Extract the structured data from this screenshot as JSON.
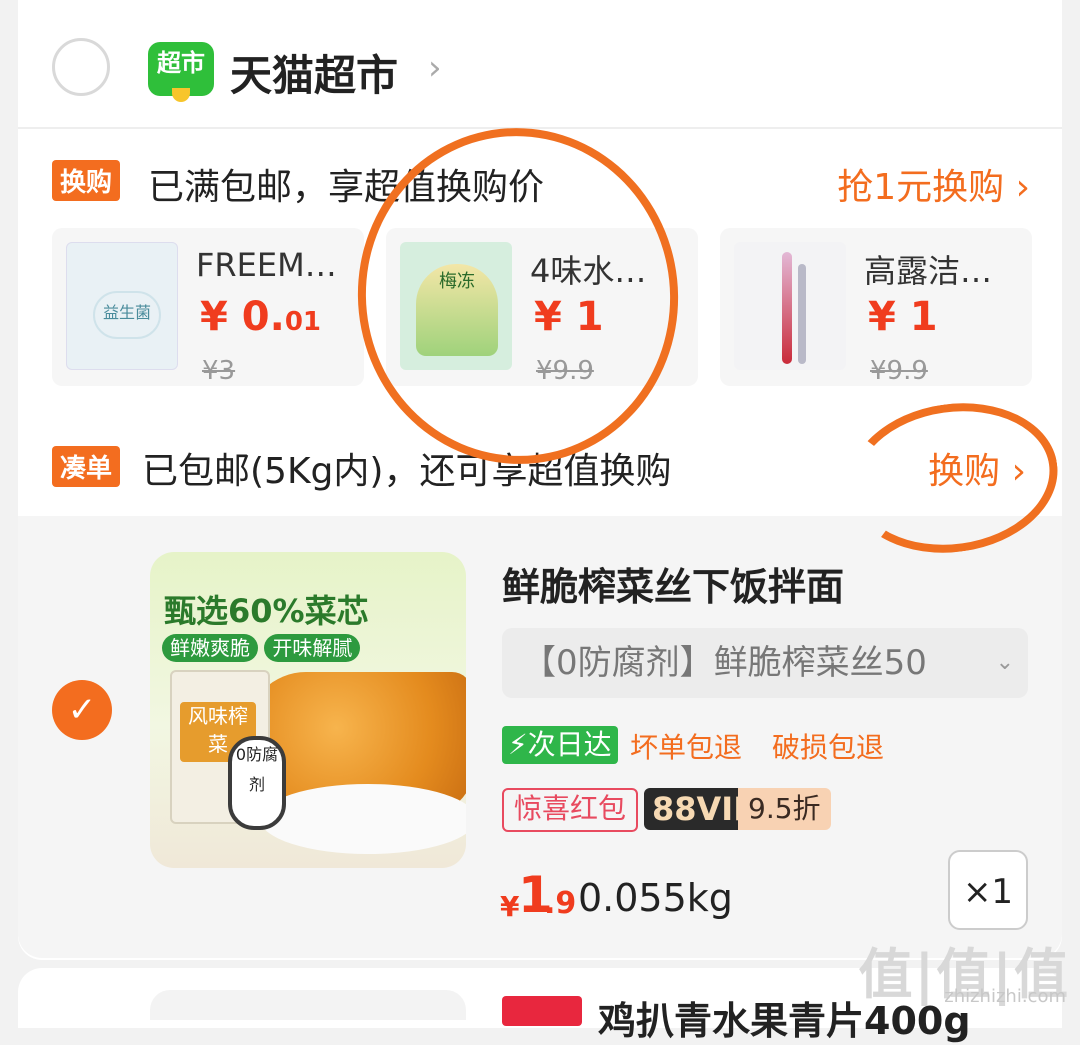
{
  "store": {
    "logo_text": "超市",
    "name": "天猫超市",
    "arrow": "›"
  },
  "exchange": {
    "tag": "换购",
    "text": "已满包邮，享超值换购价",
    "link": "抢1元换购 ›",
    "items": [
      {
        "name": "FREEM…",
        "price_symbol": "¥",
        "price_main": "0.",
        "price_minor": "01",
        "old_price": "¥3",
        "thumb_label": "益生菌"
      },
      {
        "name": "4味水…",
        "price_symbol": "¥",
        "price_main": "1",
        "price_minor": "",
        "old_price": "¥9.9",
        "thumb_label": "梅冻"
      },
      {
        "name": "高露洁…",
        "price_symbol": "¥",
        "price_main": "1",
        "price_minor": "",
        "old_price": "¥9.9",
        "thumb_label": ""
      }
    ]
  },
  "bundle": {
    "tag": "凑单",
    "text": "已包邮(5Kg内)，还可享超值换购",
    "link": "换购 ›"
  },
  "item": {
    "check": "✓",
    "image_headline": "甄选60%菜芯",
    "image_sub1": "鲜嫩爽脆",
    "image_sub2": "开味解腻",
    "image_bag": "风味榨菜",
    "image_badge": "0防腐剂",
    "title": "鲜脆榨菜丝下饭拌面",
    "spec": "【0防腐剂】鲜脆榨菜丝50",
    "spec_chevron": "⌄",
    "service_fast": "⚡次日达",
    "service_bad": "坏单包退",
    "service_broken": "破损包退",
    "badge_redpack": "惊喜红包",
    "badge_vip": "88VIP",
    "badge_discount": "9.5折",
    "price_symbol": "¥",
    "price_main": "1",
    "price_minor": ".9",
    "weight": "0.055kg",
    "qty": "×1"
  },
  "next_item": {
    "title": "鸡扒青水果青片400g"
  },
  "watermark": {
    "text": "值|值|值",
    "url": "zhizhizhi.com"
  },
  "colors": {
    "accent": "#f36d1f",
    "price": "#f03c1e",
    "green": "#2fb64a",
    "annotation": "#f07020"
  }
}
